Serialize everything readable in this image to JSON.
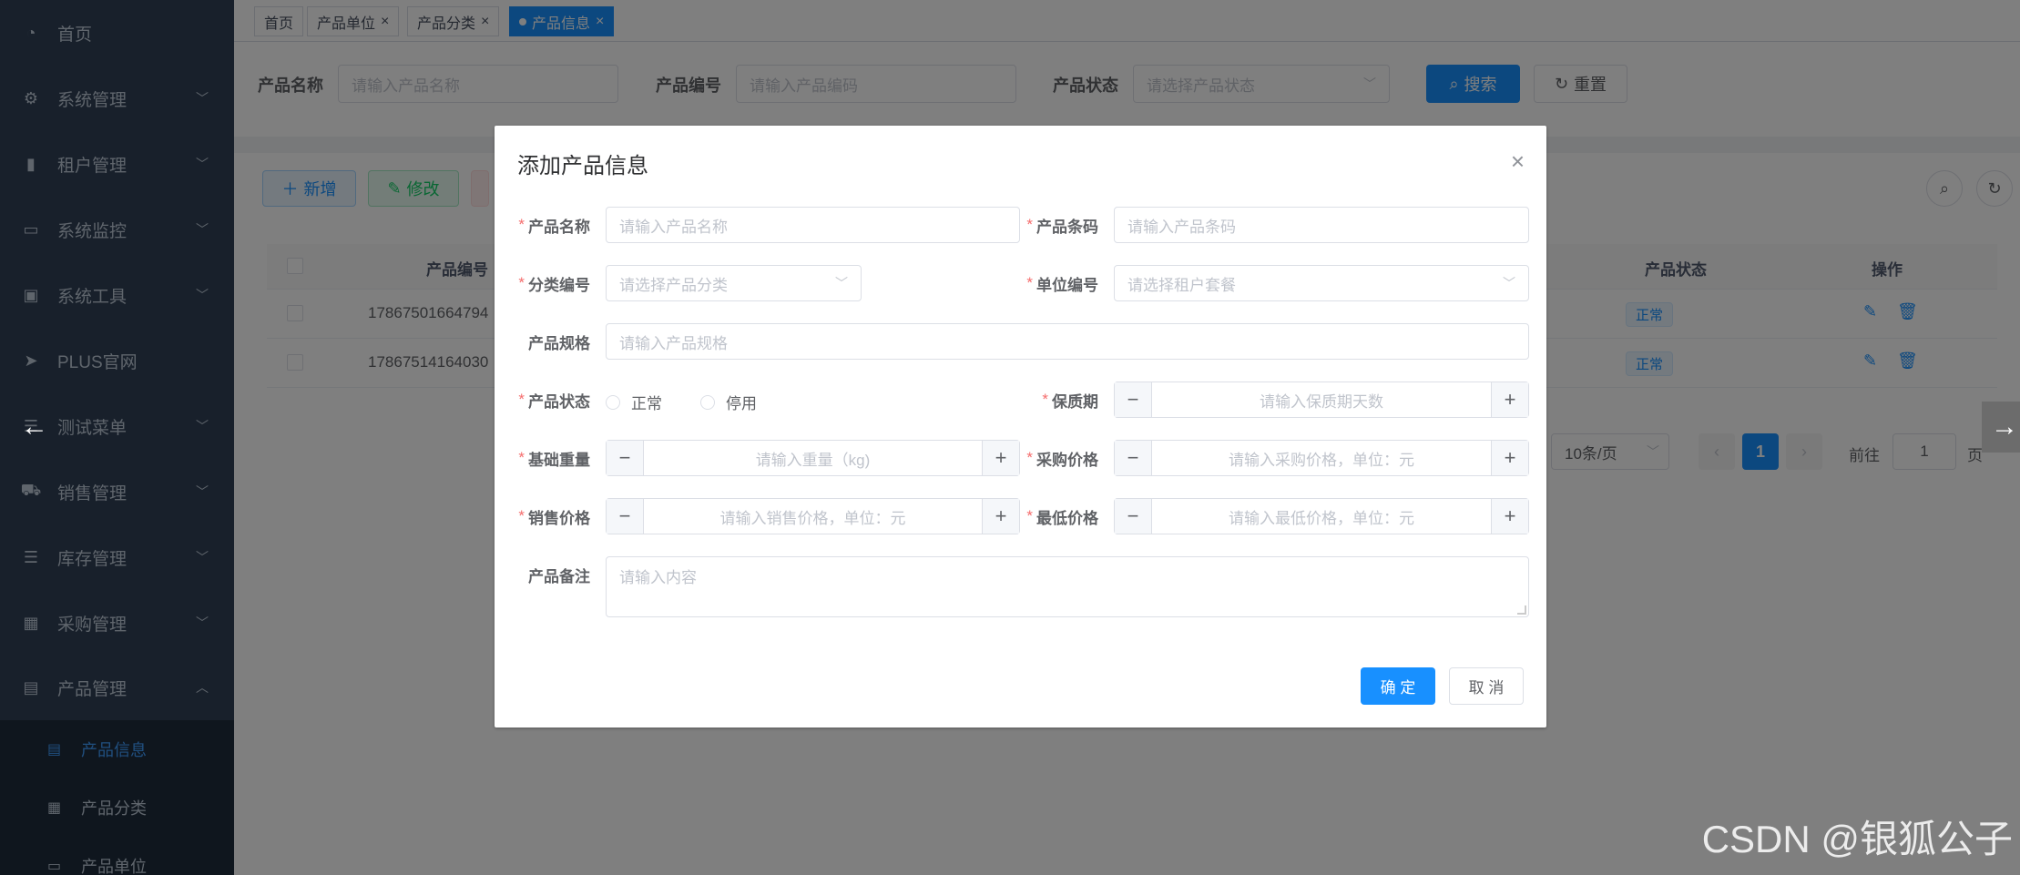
{
  "sidebar": {
    "items": [
      {
        "label": "首页",
        "icon": "dashboard-icon",
        "glyph": "◔",
        "arrow": ""
      },
      {
        "label": "系统管理",
        "icon": "gear-icon",
        "glyph": "⚙",
        "arrow": "﹀"
      },
      {
        "label": "租户管理",
        "icon": "bar-chart-icon",
        "glyph": "▮",
        "arrow": "﹀"
      },
      {
        "label": "系统监控",
        "icon": "monitor-icon",
        "glyph": "▭",
        "arrow": "﹀"
      },
      {
        "label": "系统工具",
        "icon": "toolbox-icon",
        "glyph": "▣",
        "arrow": "﹀"
      },
      {
        "label": "PLUS官网",
        "icon": "send-icon",
        "glyph": "➤",
        "arrow": ""
      },
      {
        "label": "测试菜单",
        "icon": "list-icon",
        "glyph": "☰",
        "arrow": "﹀"
      },
      {
        "label": "销售管理",
        "icon": "cart-icon",
        "glyph": "🛒",
        "arrow": "﹀"
      },
      {
        "label": "库存管理",
        "icon": "list-icon",
        "glyph": "☰",
        "arrow": "﹀"
      },
      {
        "label": "采购管理",
        "icon": "grid-icon",
        "glyph": "▦",
        "arrow": "﹀"
      },
      {
        "label": "产品管理",
        "icon": "table-icon",
        "glyph": "▤",
        "arrow": "︿"
      }
    ],
    "subitems": [
      {
        "label": "产品信息",
        "icon": "document-icon",
        "glyph": "▤",
        "active": true
      },
      {
        "label": "产品分类",
        "icon": "table-icon",
        "glyph": "▦",
        "active": false
      },
      {
        "label": "产品单位",
        "icon": "monitor-icon",
        "glyph": "▭",
        "active": false
      }
    ]
  },
  "tags": [
    {
      "label": "首页",
      "closable": false,
      "active": false
    },
    {
      "label": "产品单位",
      "closable": true,
      "active": false
    },
    {
      "label": "产品分类",
      "closable": true,
      "active": false
    },
    {
      "label": "产品信息",
      "closable": true,
      "active": true
    }
  ],
  "search": {
    "name_label": "产品名称",
    "name_placeholder": "请输入产品名称",
    "code_label": "产品编号",
    "code_placeholder": "请输入产品编码",
    "status_label": "产品状态",
    "status_placeholder": "请选择产品状态",
    "search_btn": "搜索",
    "reset_btn": "重置"
  },
  "toolbar": {
    "add_btn": "新增",
    "edit_btn": "修改"
  },
  "table": {
    "headers": {
      "code": "产品编号",
      "status": "产品状态",
      "ops": "操作"
    },
    "rows": [
      {
        "code": "17867501664794",
        "status": "正常"
      },
      {
        "code": "17867514164030",
        "status": "正常"
      }
    ]
  },
  "pagination": {
    "page_size": "10条/页",
    "current": "1",
    "goto_label": "前往",
    "goto_value": "1",
    "page_suffix": "页"
  },
  "dialog": {
    "title": "添加产品信息",
    "close": "×",
    "fields": {
      "name": {
        "label": "产品名称",
        "placeholder": "请输入产品名称",
        "required": "*"
      },
      "barcode": {
        "label": "产品条码",
        "placeholder": "请输入产品条码",
        "required": "*"
      },
      "category": {
        "label": "分类编号",
        "placeholder": "请选择产品分类",
        "required": "*"
      },
      "unit": {
        "label": "单位编号",
        "placeholder": "请选择租户套餐",
        "required": "*"
      },
      "spec": {
        "label": "产品规格",
        "placeholder": "请输入产品规格"
      },
      "status": {
        "label": "产品状态",
        "required": "*",
        "options": [
          "正常",
          "停用"
        ]
      },
      "shelf_life": {
        "label": "保质期",
        "placeholder": "请输入保质期天数",
        "required": "*"
      },
      "weight": {
        "label": "基础重量",
        "placeholder": "请输入重量（kg)",
        "required": "*"
      },
      "purchase_price": {
        "label": "采购价格",
        "placeholder": "请输入采购价格，单位：元",
        "required": "*"
      },
      "sale_price": {
        "label": "销售价格",
        "placeholder": "请输入销售价格，单位：元",
        "required": "*"
      },
      "min_price": {
        "label": "最低价格",
        "placeholder": "请输入最低价格，单位：元",
        "required": "*"
      },
      "remark": {
        "label": "产品备注",
        "placeholder": "请输入内容"
      }
    },
    "confirm": "确 定",
    "cancel": "取 消"
  },
  "watermark": "CSDN @银狐公子",
  "colors": {
    "primary": "#1890ff",
    "sidebar_bg": "#304156",
    "required": "#f56c6c"
  }
}
